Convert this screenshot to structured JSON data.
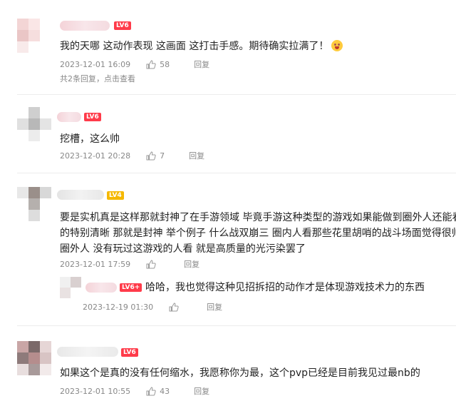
{
  "comments": [
    {
      "level": "LV6",
      "lines": [
        "我的天哪 这动作表现 这画面 这打击手感。期待确实拉满了！"
      ],
      "date": "2023-12-01 16:09",
      "likes": "58",
      "reply_label": "回复",
      "more_replies": "共2条回复，点击查看"
    },
    {
      "level": "LV6",
      "lines": [
        "挖槽，这么帅"
      ],
      "date": "2023-12-01 20:28",
      "likes": "7",
      "reply_label": "回复"
    },
    {
      "level": "LV4",
      "lines": [
        "要是实机真是这样那就封神了在手游领域 毕竟手游这种类型的游戏如果能做到圈外人还能看",
        "的特别清晰 那就是封神 举个例子 什么战双崩三 圈内人看那些花里胡哨的战斗场面觉得很帅",
        "圈外人 没有玩过这游戏的人看 就是高质量的光污染罢了"
      ],
      "date": "2023-12-01 17:59",
      "likes": "0",
      "reply_label": "回复",
      "sub_reply": {
        "level": "LV6+",
        "text": "哈哈，我也觉得这种见招拆招的动作才是体现游戏技术力的东西",
        "date": "2023-12-19 01:30"
      }
    },
    {
      "level": "LV6",
      "lines": [
        "如果这个是真的没有任何缩水，我愿称你为最，这个pvp已经是目前我见过最nb的"
      ],
      "date": "2023-12-01 10:55",
      "likes": "43",
      "reply_label": "回复"
    }
  ],
  "colors": {
    "level_badge": "#ff3b4a",
    "text": "#222222",
    "meta": "#888888"
  }
}
